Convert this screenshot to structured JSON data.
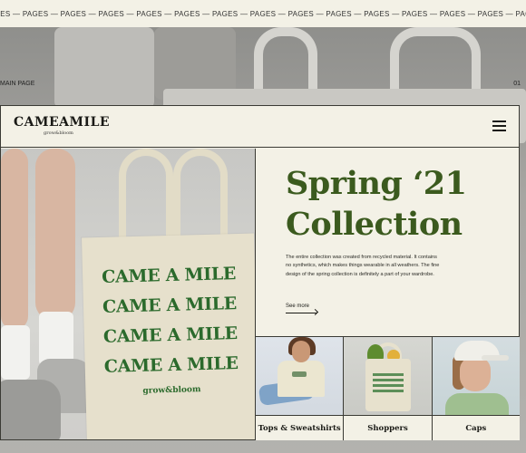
{
  "marquee": {
    "text": "PAGES — PAGES — PAGES — PAGES — PAGES — PAGES — PAGES — PAGES — PAGES — PAGES — PAGES — PAGES — PAGES — PAGES — PAGES — PAGES — PAGES — PAGES — PAGES"
  },
  "meta": {
    "left_label": "MAIN PAGE",
    "right_label": "01"
  },
  "header": {
    "brand": "CAMEAMILE",
    "tagline": "grow&bloom",
    "menu_icon": "hamburger-menu-icon"
  },
  "hero": {
    "tote_lines": [
      "CAME A MILE",
      "CAME A MILE",
      "CAME A MILE",
      "CAME A MILE"
    ],
    "tote_footer": "grow&bloom"
  },
  "content": {
    "headline_line1": "Spring ‘21",
    "headline_line2": "Collection",
    "description": "The entire collection was created from recycled material. It contains no synthetics, which makes things wearable in all weathers. The fine design of the spring collection is definitely a part of your wardrobe.",
    "see_more": "See more"
  },
  "categories": [
    {
      "label": "Tops & Sweatshirts"
    },
    {
      "label": "Shoppers"
    },
    {
      "label": "Caps"
    }
  ],
  "colors": {
    "background": "#f3f1e6",
    "headline_green": "#3b5a1e",
    "tote_green": "#2b6a2c",
    "border": "#3a3a34"
  }
}
